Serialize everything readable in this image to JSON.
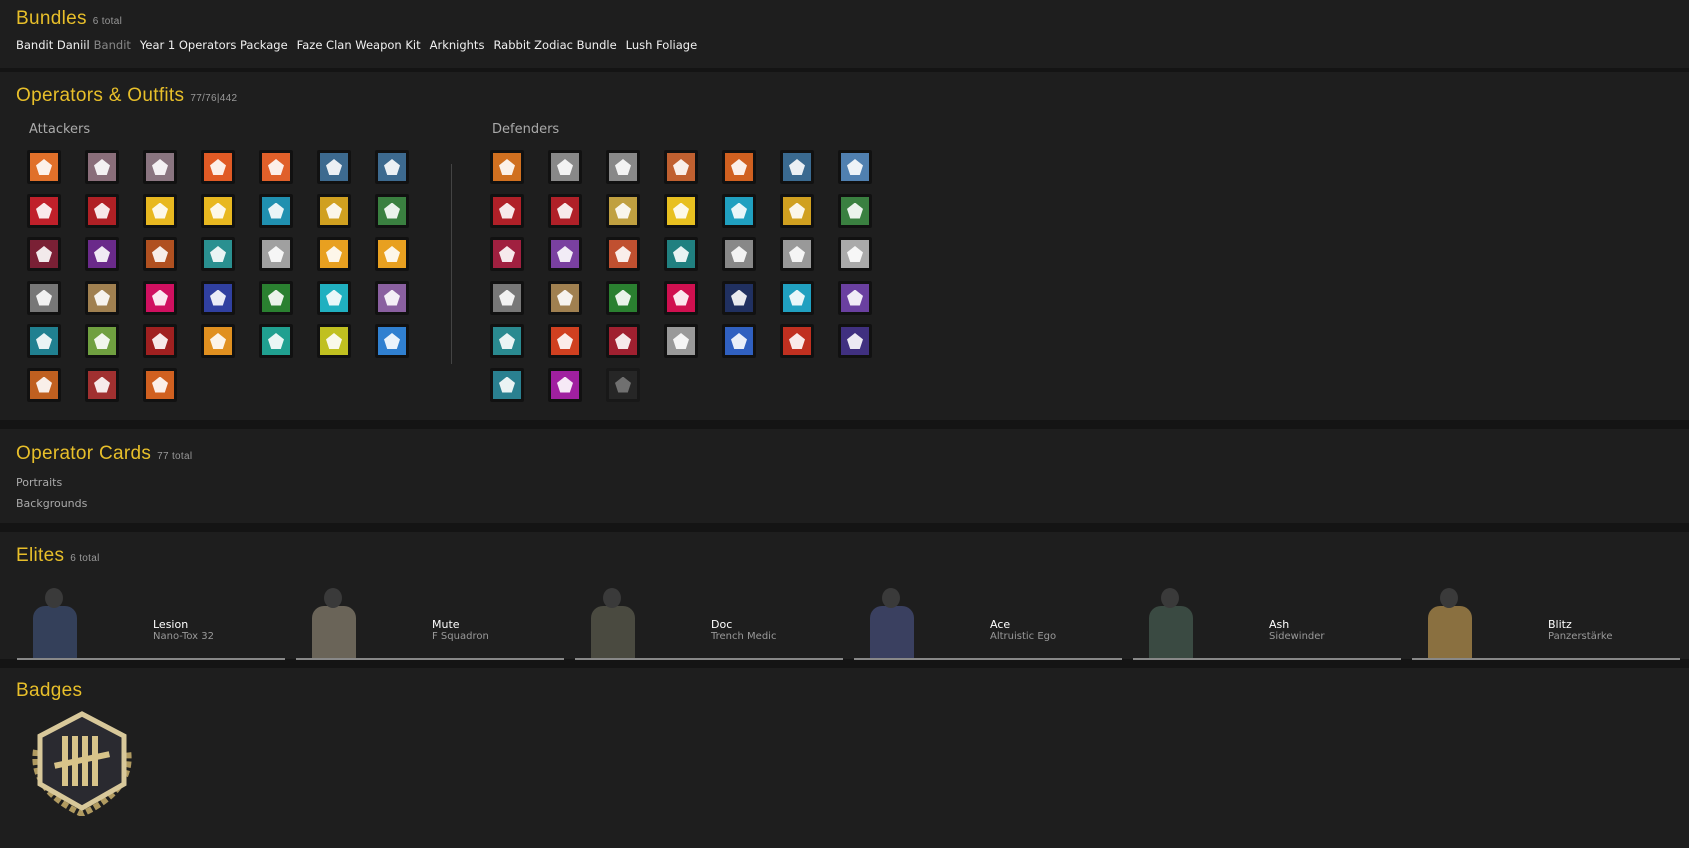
{
  "bundles": {
    "title": "Bundles",
    "count": "6 total",
    "items": [
      {
        "label": "Bandit Daniil",
        "tag": "Bandit"
      },
      {
        "label": "Year 1 Operators Package"
      },
      {
        "label": "Faze Clan Weapon Kit"
      },
      {
        "label": "Arknights"
      },
      {
        "label": "Rabbit Zodiac Bundle"
      },
      {
        "label": "Lush Foliage"
      }
    ]
  },
  "operators": {
    "title": "Operators & Outfits",
    "count": "77/76|442",
    "attackers_label": "Attackers",
    "defenders_label": "Defenders",
    "attackers": [
      "#e0702a",
      "#8a6e7a",
      "#8a7580",
      "#e05a25",
      "#e0602a",
      "#3d6a8f",
      "#3d6a8f",
      "#c0202a",
      "#b02025",
      "#e8b820",
      "#e8b820",
      "#2090b0",
      "#d0a020",
      "#3a8040",
      "#7a2035",
      "#6a2a8a",
      "#b05020",
      "#2a9090",
      "#a0a0a0",
      "#e8a020",
      "#e8a020",
      "#777777",
      "#a08050",
      "#d01060",
      "#3040a0",
      "#2a8030",
      "#20b0c0",
      "#8a60a0",
      "#208090",
      "#70a040",
      "#a02020",
      "#e09020",
      "#20a090",
      "#c0c020",
      "#3080d0",
      "#c06020",
      "#a03030",
      "#d06020"
    ],
    "defenders": [
      "#d07020",
      "#888888",
      "#888888",
      "#c06030",
      "#d06020",
      "#3a6a90",
      "#5080b0",
      "#b02028",
      "#b02028",
      "#c0a040",
      "#e8c020",
      "#20a0c0",
      "#d0a020",
      "#3a8040",
      "#a02040",
      "#7a40a0",
      "#c05030",
      "#208080",
      "#888888",
      "#999999",
      "#aaaaaa",
      "#777777",
      "#a08050",
      "#2a8030",
      "#d01050",
      "#203060",
      "#20a0c0",
      "#6a40a0",
      "#2a8a90",
      "#d04020",
      "#a02030",
      "#999999",
      "#3060c0",
      "#c03020",
      "#403080",
      "#2a8090",
      "#a020a0",
      "#333333"
    ]
  },
  "cards": {
    "title": "Operator Cards",
    "count": "77 total",
    "links": [
      "Portraits",
      "Backgrounds"
    ]
  },
  "elites": {
    "title": "Elites",
    "count": "6 total",
    "items": [
      {
        "name": "Lesion",
        "skin": "Nano-Tox 32",
        "color": "#34405a"
      },
      {
        "name": "Mute",
        "skin": "F Squadron",
        "color": "#6a6458"
      },
      {
        "name": "Doc",
        "skin": "Trench Medic",
        "color": "#4a4a40"
      },
      {
        "name": "Ace",
        "skin": "Altruistic Ego",
        "color": "#3a4060"
      },
      {
        "name": "Ash",
        "skin": "Sidewinder",
        "color": "#3a4a42"
      },
      {
        "name": "Blitz",
        "skin": "Panzerstärke",
        "color": "#8a7040"
      }
    ]
  },
  "badges": {
    "title": "Badges"
  }
}
